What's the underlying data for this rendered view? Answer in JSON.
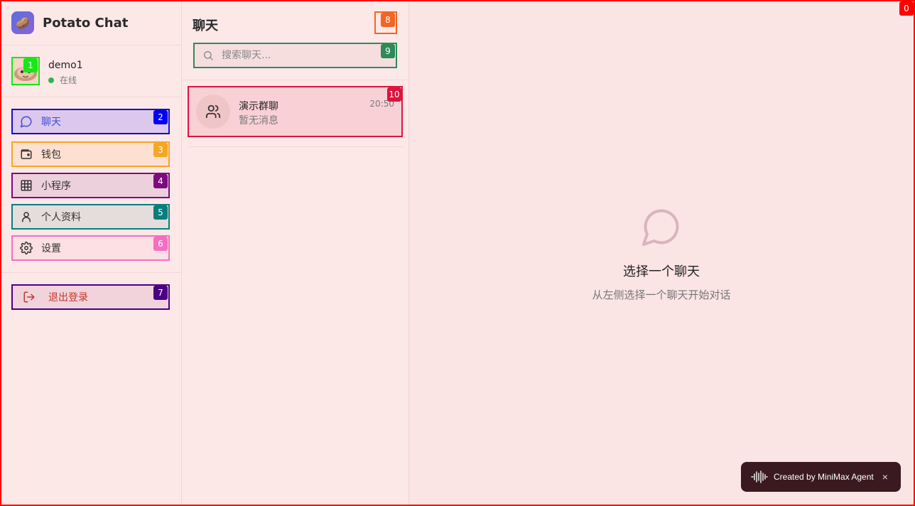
{
  "app": {
    "name": "Potato Chat"
  },
  "user": {
    "name": "demo1",
    "status": "在线"
  },
  "nav": [
    {
      "label": "聊天",
      "icon": "message-circle-icon"
    },
    {
      "label": "钱包",
      "icon": "wallet-icon"
    },
    {
      "label": "小程序",
      "icon": "grid-icon"
    },
    {
      "label": "个人资料",
      "icon": "user-icon"
    },
    {
      "label": "设置",
      "icon": "gear-icon"
    }
  ],
  "logout": {
    "label": "退出登录",
    "icon": "logout-icon"
  },
  "chats_panel": {
    "title": "聊天",
    "search_placeholder": "搜索聊天...",
    "items": [
      {
        "name": "演示群聊",
        "time": "20:50",
        "last_message": "暂无消息"
      }
    ]
  },
  "empty_state": {
    "title": "选择一个聊天",
    "subtitle": "从左侧选择一个聊天开始对话"
  },
  "toast": {
    "text": "Created by MiniMax Agent",
    "close": "×"
  },
  "badges": [
    "0",
    "1",
    "2",
    "3",
    "4",
    "5",
    "6",
    "7",
    "8",
    "9",
    "10"
  ],
  "colors": {
    "accent": "#3b4cd9",
    "logout": "#c0392b",
    "online": "#2ab84a"
  }
}
